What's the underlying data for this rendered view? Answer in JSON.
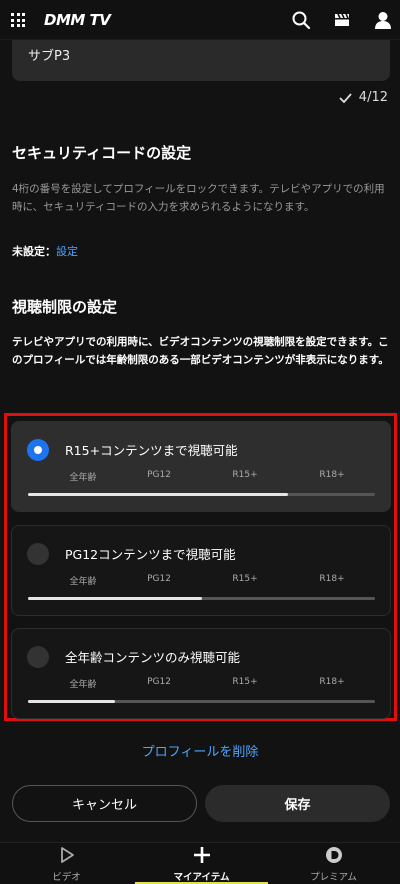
{
  "header": {
    "logo": "DMM TV",
    "icons": [
      "grid-icon",
      "search-icon",
      "clapperboard-icon",
      "user-icon"
    ]
  },
  "profile": {
    "sub_name_value": "サブP3",
    "name_counter": "4/12"
  },
  "security": {
    "title": "セキュリティコードの設定",
    "description": "4桁の番号を設定してプロフィールをロックできます。テレビやアプリでの利用時に、セキュリティコードの入力を求められるようになります。",
    "status_label": "未設定：",
    "set_link": "設定"
  },
  "viewing_limit": {
    "title": "視聴制限の設定",
    "description": "テレビやアプリでの利用時に、ビデオコンテンツの視聴制限を設定できます。このプロフィールでは年齢制限のある一部ビデオコンテンツが非表示になります。",
    "tick_labels": [
      "全年齢",
      "PG12",
      "R15+",
      "R18+"
    ],
    "options": [
      {
        "label": "R15+コンテンツまで視聴可能",
        "selected": true,
        "level": 0.75
      },
      {
        "label": "PG12コンテンツまで視聴可能",
        "selected": false,
        "level": 0.5
      },
      {
        "label": "全年齢コンテンツのみ視聴可能",
        "selected": false,
        "level": 0.25
      }
    ],
    "highlight_color": "#e10e0e"
  },
  "actions": {
    "delete_profile": "プロフィールを削除",
    "cancel": "キャンセル",
    "save": "保存"
  },
  "bottom_nav": {
    "items": [
      {
        "label": "ビデオ",
        "icon": "play-icon",
        "active": false
      },
      {
        "label": "マイアイテム",
        "icon": "plus-icon",
        "active": true
      },
      {
        "label": "プレミアム",
        "icon": "premium-icon",
        "active": false
      }
    ]
  },
  "colors": {
    "accent_blue": "#1e74f0",
    "link_blue": "#4fa3ff",
    "active_underline": "#e5e04a"
  }
}
